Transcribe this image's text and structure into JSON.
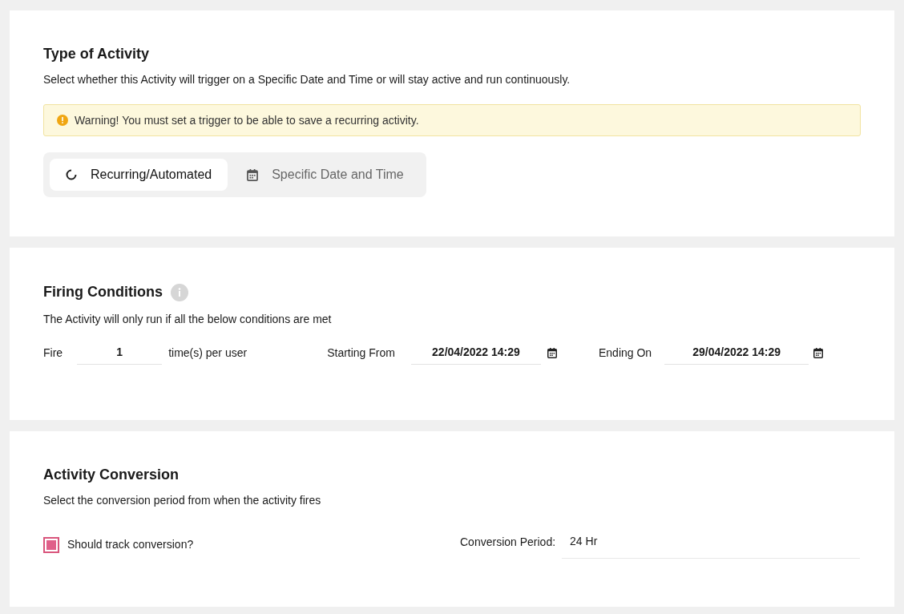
{
  "activity_type": {
    "title": "Type of Activity",
    "description": "Select whether this Activity will trigger on a Specific Date and Time or will stay active and run continuously.",
    "warning": "Warning! You must set a trigger to be able to save a recurring activity.",
    "tabs": [
      {
        "label": "Recurring/Automated",
        "kind": "recurring",
        "selected": true
      },
      {
        "label": "Specific Date and Time",
        "kind": "date",
        "selected": false
      }
    ]
  },
  "firing_conditions": {
    "title": "Firing Conditions",
    "description": "The Activity will only run if all the below conditions are met",
    "fire_label": "Fire",
    "fire_count": "1",
    "fire_suffix": "time(s) per user",
    "start_label": "Starting From",
    "start_value": "22/04/2022 14:29",
    "end_label": "Ending On",
    "end_value": "29/04/2022 14:29"
  },
  "activity_conversion": {
    "title": "Activity Conversion",
    "description": "Select the conversion period from when the activity fires",
    "track": {
      "label": "Should track conversion?",
      "checked": true
    },
    "period_label": "Conversion Period:",
    "period_value": "24 Hr"
  }
}
